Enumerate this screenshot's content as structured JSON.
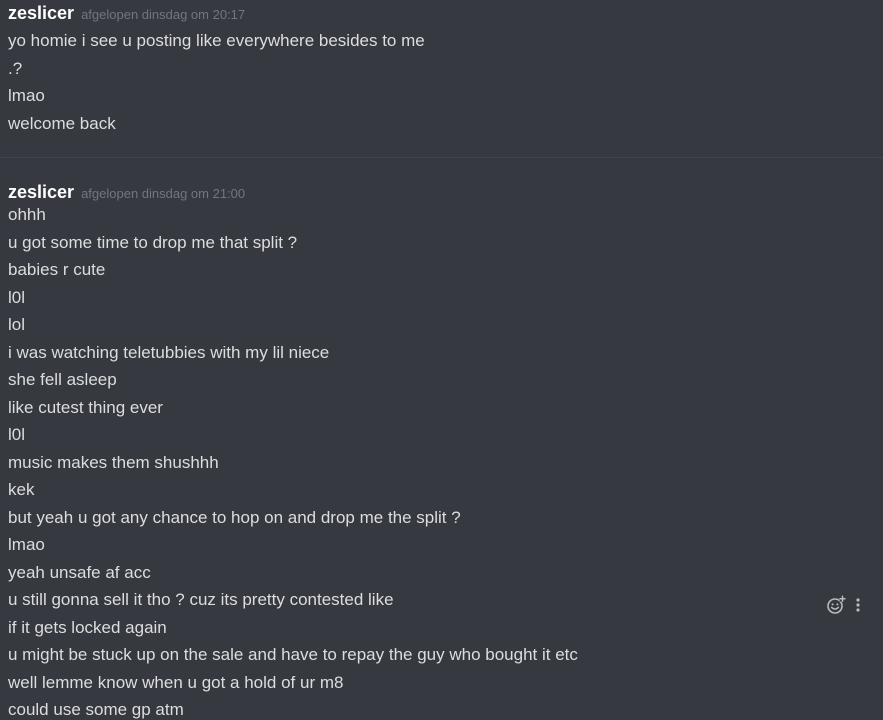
{
  "groups": [
    {
      "author": "zeslicer",
      "timestamp": "afgelopen dinsdag om 20:17",
      "messages": [
        "yo homie i see u posting like everywhere besides to me",
        ".?",
        "lmao",
        "welcome back"
      ]
    },
    {
      "author": "zeslicer",
      "timestamp": "afgelopen dinsdag om 21:00",
      "messages": [
        "ohhh",
        "u got some time to drop me that split ?",
        "babies r cute",
        "l0l",
        "lol",
        "i was watching teletubbies with my lil niece",
        "she fell asleep",
        "like cutest thing ever",
        "l0l",
        "music makes them shushhh",
        "kek",
        "but yeah u got any chance to hop on and drop me the split ?",
        "lmao",
        "yeah unsafe af acc",
        "u still gonna sell it tho ? cuz its pretty contested like",
        "if it gets locked again",
        "u might be stuck up on the sale and have to repay the guy who bought it etc",
        "well lemme know when u got a hold of ur m8",
        "could use some gp atm"
      ]
    }
  ],
  "hover_actions": {
    "icons": [
      "add-reaction-icon",
      "more-options-icon"
    ]
  },
  "colors": {
    "background": "#36393f",
    "username": "#ffffff",
    "timestamp": "#72767d",
    "message_text": "#dcddde",
    "divider": "#40444b",
    "icon": "#b9bbbe"
  }
}
